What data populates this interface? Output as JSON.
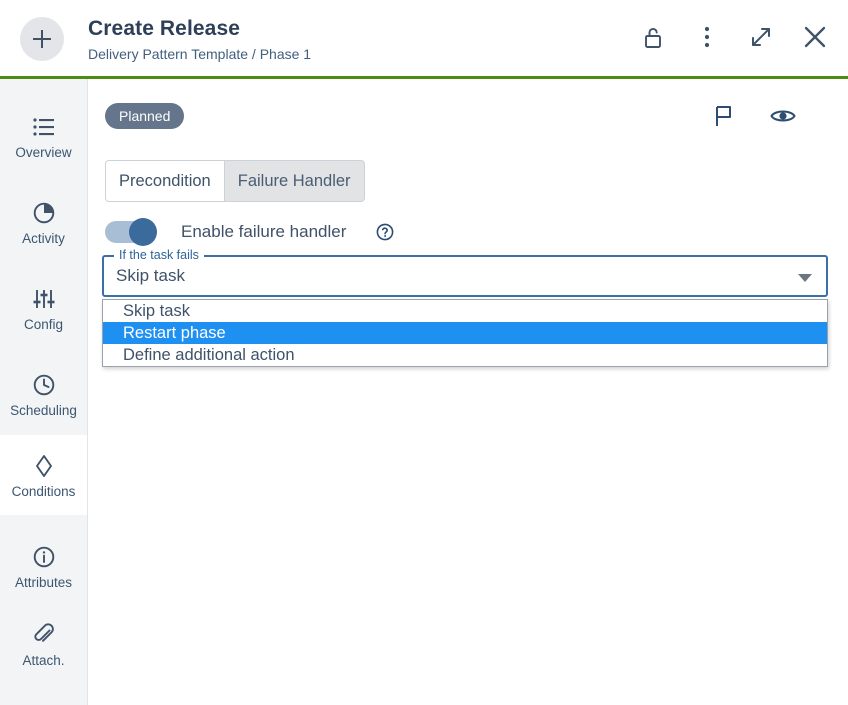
{
  "header": {
    "add_button_icon": "plus-icon",
    "title": "Create Release",
    "subtitle": "Delivery Pattern Template / Phase 1",
    "actions": [
      {
        "name": "unlock-icon",
        "label": "Unlock"
      },
      {
        "name": "more-vertical-icon",
        "label": "More options"
      },
      {
        "name": "expand-icon",
        "label": "Expand"
      },
      {
        "name": "close-icon",
        "label": "Close"
      }
    ]
  },
  "sidebar": {
    "items": [
      {
        "label": "Overview",
        "icon": "list-icon",
        "selected": false
      },
      {
        "label": "Activity",
        "icon": "pie-chart-icon",
        "selected": false
      },
      {
        "label": "Config",
        "icon": "sliders-icon",
        "selected": false
      },
      {
        "label": "Scheduling",
        "icon": "clock-icon",
        "selected": false
      },
      {
        "label": "Conditions",
        "icon": "diamond-icon",
        "selected": true
      },
      {
        "label": "Attributes",
        "icon": "info-icon",
        "selected": false
      },
      {
        "label": "Attach.",
        "icon": "paperclip-icon",
        "selected": false
      }
    ]
  },
  "main": {
    "status_badge": "Planned",
    "actions": [
      {
        "name": "flag-icon",
        "label": "Flag"
      },
      {
        "name": "eye-icon",
        "label": "Watch"
      }
    ],
    "tabs": [
      {
        "label": "Precondition",
        "active": false
      },
      {
        "label": "Failure Handler",
        "active": true
      }
    ],
    "toggle": {
      "enabled": true,
      "label": "Enable failure handler",
      "help_icon": "question-circle-icon"
    },
    "select": {
      "legend": "If the task fails",
      "value": "Skip task",
      "caret_icon": "chevron-down-icon",
      "options": [
        {
          "label": "Skip task",
          "highlighted": false
        },
        {
          "label": "Restart phase",
          "highlighted": true
        },
        {
          "label": "Define additional action",
          "highlighted": false
        }
      ]
    }
  },
  "colors": {
    "accent_green": "#4d8c14",
    "badge_gray": "#65758b",
    "option_highlight": "#1e90f2",
    "field_border_blue": "#3b6fa8",
    "toggle_knob": "#3a6b9c",
    "toggle_track": "#a8bed4",
    "sidebar_bg": "#f2f4f6",
    "text": "#3f5268"
  }
}
